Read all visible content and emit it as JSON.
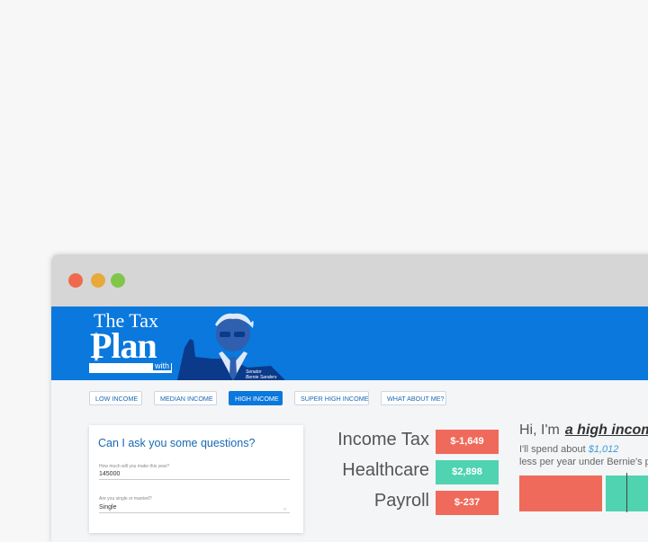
{
  "window": {
    "colors": {
      "close": "#ef6a4d",
      "minimize": "#e8a93b",
      "maximize": "#7fc64a",
      "banner": "#0a78dd",
      "accent": "#1768b5",
      "negative": "#ef6a5a",
      "positive": "#4fd3b1"
    }
  },
  "banner": {
    "logo_the": "The Tax",
    "logo_plan": "Plan",
    "logo_with": "with",
    "caption_line1": "Senator",
    "caption_line2": "Bernie Sanders"
  },
  "tabs": [
    {
      "label": "LOW INCOME",
      "active": false
    },
    {
      "label": "MEDIAN INCOME",
      "active": false
    },
    {
      "label": "HIGH INCOME",
      "active": true
    },
    {
      "label": "SUPER HIGH INCOME",
      "active": false
    },
    {
      "label": "WHAT ABOUT ME?",
      "active": false
    }
  ],
  "questions": {
    "title": "Can I ask you some questions?",
    "q1_label": "How much will you make this year?",
    "q1_value": "145000",
    "q2_label": "Are you single or married?",
    "q2_value": "Single"
  },
  "categories": [
    {
      "label": "Income Tax",
      "value": "$-1,649",
      "tone": "negative"
    },
    {
      "label": "Healthcare",
      "value": "$2,898",
      "tone": "positive"
    },
    {
      "label": "Payroll",
      "value": "$-237",
      "tone": "negative"
    }
  ],
  "summary": {
    "greeting": "Hi, I'm",
    "persona": "a high income",
    "spend_prefix": "I'll spend about",
    "spend_amount": "$1,012",
    "spend_suffix": "less per year under Bernie's p"
  },
  "chevron_icon": "chevron-down-icon"
}
